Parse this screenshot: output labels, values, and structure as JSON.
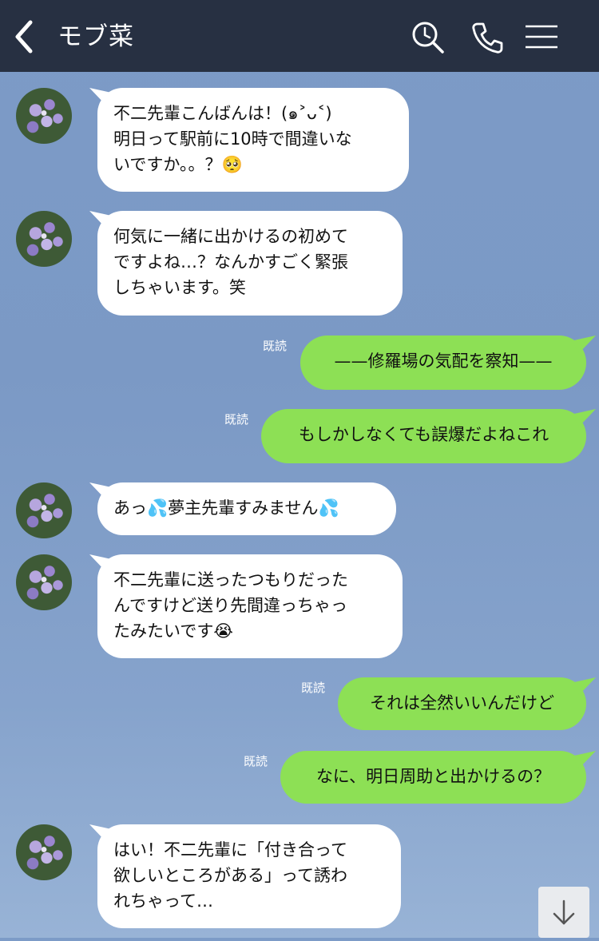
{
  "header": {
    "back_icon": "chevron-left-icon",
    "title": "モブ菜",
    "search_icon": "search-icon",
    "call_icon": "phone-icon",
    "menu_icon": "menu-icon"
  },
  "read_label": "既読",
  "messages": [
    {
      "side": "in",
      "text": "不二先輩こんばんは！(๑˃ᴗ˂)\n明日って駅前に10時で間違いな\nいですか。。？🥺"
    },
    {
      "side": "in",
      "text": "何気に一緒に出かけるの初めて\nですよね…？なんかすごく緊張\nしちゃいます。笑"
    },
    {
      "side": "out",
      "text": "——修羅場の気配を察知——",
      "read": "既読"
    },
    {
      "side": "out",
      "text": "もしかしなくても誤爆だよねこれ",
      "read": "既読"
    },
    {
      "side": "in",
      "text": "あっ💦夢主先輩すみません💦"
    },
    {
      "side": "in",
      "text": "不二先輩に送ったつもりだった\nんですけど送り先間違っちゃっ\nたみたいです😭"
    },
    {
      "side": "out",
      "text": "それは全然いいんだけど",
      "read": "既読"
    },
    {
      "side": "out",
      "text": "なに、明日周助と出かけるの？",
      "read": "既読"
    },
    {
      "side": "in",
      "text": "はい！不二先輩に「付き合って\n欲しいところがある」って誘わ\nれちゃって…"
    }
  ],
  "scroll_down_icon": "arrow-down-icon",
  "colors": {
    "header_bg": "#273042",
    "incoming_bubble": "#ffffff",
    "outgoing_bubble": "#8de055",
    "chat_bg": "#7c9bc7"
  }
}
